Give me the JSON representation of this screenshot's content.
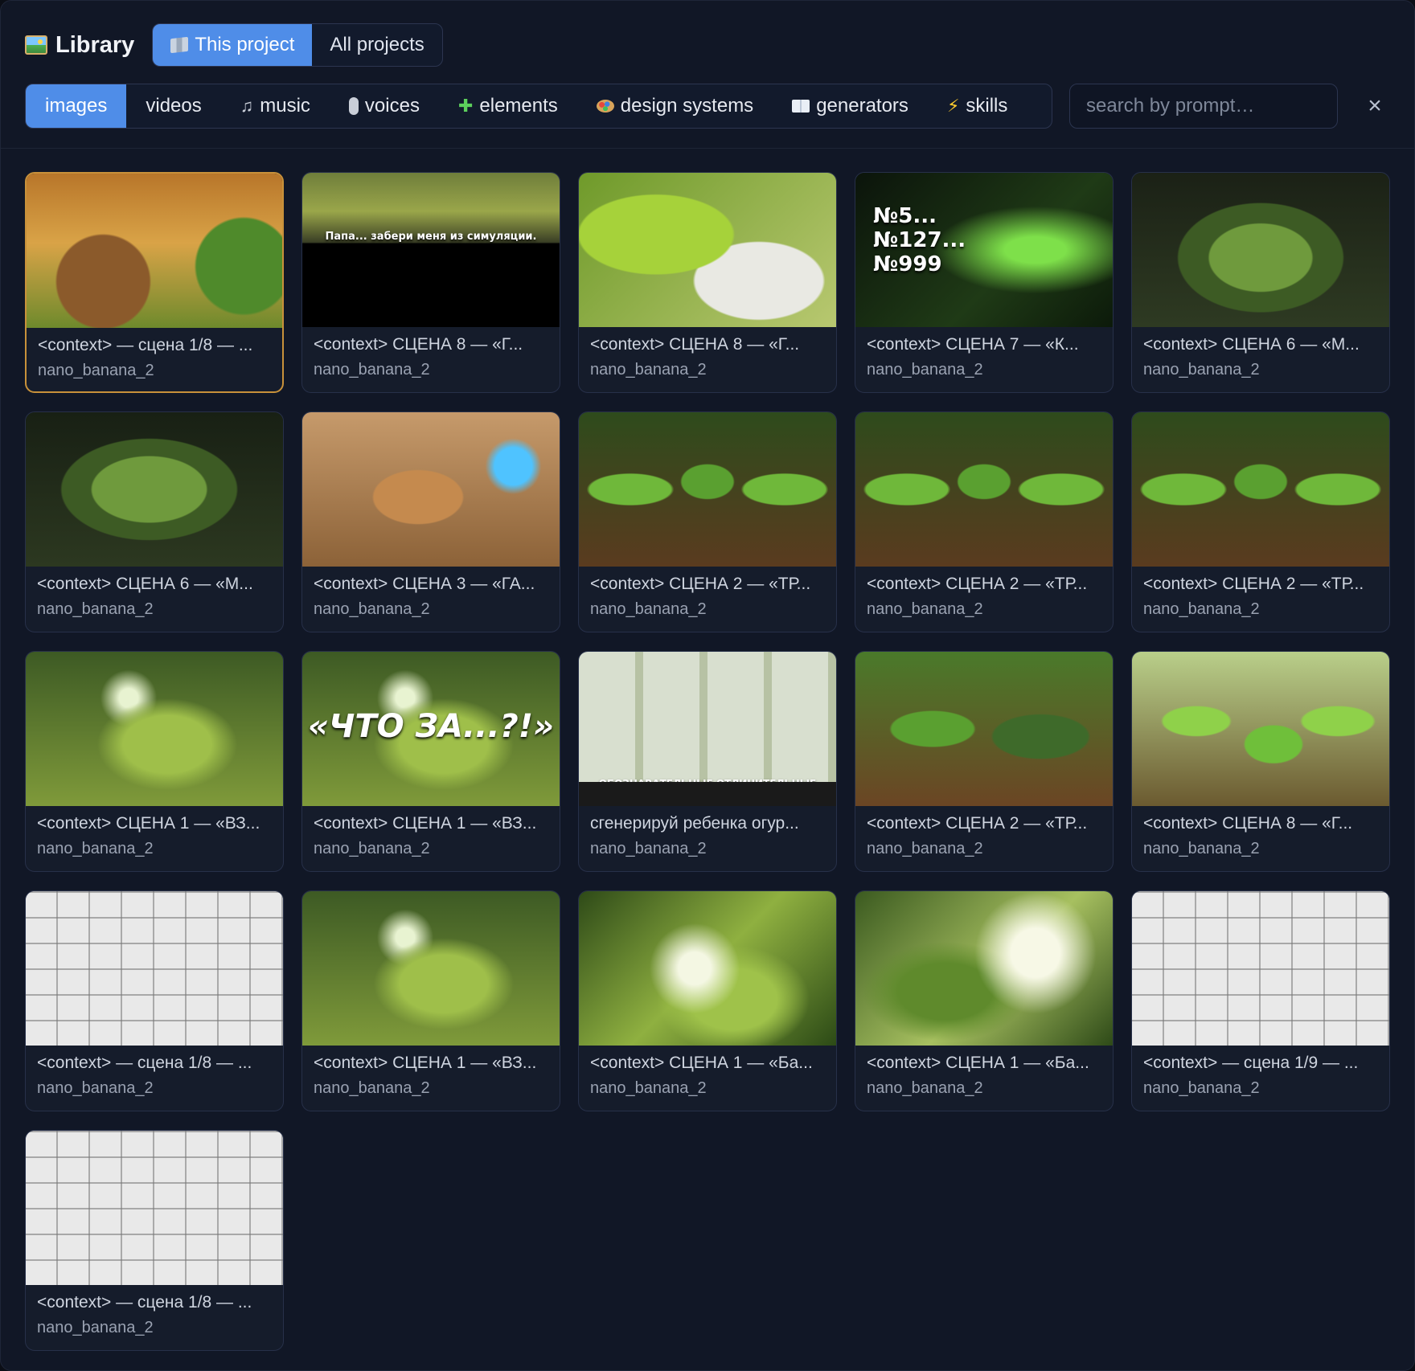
{
  "header": {
    "title": "Library",
    "scope_tabs": [
      {
        "label": "This project",
        "active": true
      },
      {
        "label": "All projects",
        "active": false
      }
    ]
  },
  "filters": [
    {
      "label": "images",
      "icon": "",
      "active": true
    },
    {
      "label": "videos",
      "icon": "",
      "active": false
    },
    {
      "label": "music",
      "icon": "music-note-icon",
      "active": false
    },
    {
      "label": "voices",
      "icon": "microphone-icon",
      "active": false
    },
    {
      "label": "elements",
      "icon": "puzzle-icon",
      "active": false
    },
    {
      "label": "design systems",
      "icon": "palette-icon",
      "active": false
    },
    {
      "label": "generators",
      "icon": "book-icon",
      "active": false
    },
    {
      "label": "skills",
      "icon": "lightning-icon",
      "active": false
    }
  ],
  "search": {
    "placeholder": "search by prompt…",
    "value": ""
  },
  "close_icon": "×",
  "items": [
    {
      "caption": "<context> — сцена 1/8 — ...",
      "model": "nano_banana_2",
      "thumb": "t-city",
      "overlay": "",
      "selected": true
    },
    {
      "caption": "<context> СЦЕНА 8 — «Г...",
      "model": "nano_banana_2",
      "thumb": "t-papa",
      "overlay": "Папа... забери меня из симуляции.",
      "selected": false
    },
    {
      "caption": "<context> СЦЕНА 8 — «Г...",
      "model": "nano_banana_2",
      "thumb": "t-pack",
      "overlay": "",
      "selected": false
    },
    {
      "caption": "<context> СЦЕНА 7 — «К...",
      "model": "nano_banana_2",
      "thumb": "t-roots",
      "overlay": "№5...\n№127...\n№999",
      "selected": false
    },
    {
      "caption": "<context> СЦЕНА 6 — «М...",
      "model": "nano_banana_2",
      "thumb": "t-glass",
      "overlay": "",
      "selected": false
    },
    {
      "caption": "<context> СЦЕНА 6 — «М...",
      "model": "nano_banana_2",
      "thumb": "t-glass2",
      "overlay": "",
      "selected": false
    },
    {
      "caption": "<context> СЦЕНА 3 — «ГА...",
      "model": "nano_banana_2",
      "thumb": "t-sheriff",
      "overlay": "",
      "selected": false
    },
    {
      "caption": "<context> СЦЕНА 2 — «ТР...",
      "model": "nano_banana_2",
      "thumb": "t-cukes",
      "overlay": "",
      "selected": false
    },
    {
      "caption": "<context> СЦЕНА 2 — «ТР...",
      "model": "nano_banana_2",
      "thumb": "t-cukes",
      "overlay": "",
      "selected": false
    },
    {
      "caption": "<context> СЦЕНА 2 — «ТР...",
      "model": "nano_banana_2",
      "thumb": "t-cukes",
      "overlay": "",
      "selected": false
    },
    {
      "caption": "<context> СЦЕНА 1 — «ВЗ...",
      "model": "nano_banana_2",
      "thumb": "t-jar",
      "overlay": "",
      "selected": false
    },
    {
      "caption": "<context> СЦЕНА 1 — «ВЗ...",
      "model": "nano_banana_2",
      "thumb": "t-jar",
      "overlay": "«ЧТО ЗА...?!»",
      "selected": false
    },
    {
      "caption": "сгенерируй ребенка огур...",
      "model": "nano_banana_2",
      "thumb": "t-panels",
      "overlay": "ОБОЗНАВАТЕЛЬНЫЕ ОТЛИЧИТЕЛЬНЫЕ ЗНАКИ",
      "selected": false
    },
    {
      "caption": "<context> СЦЕНА 2 — «ТР...",
      "model": "nano_banana_2",
      "thumb": "t-garden",
      "overlay": "",
      "selected": false
    },
    {
      "caption": "<context> СЦЕНА 8 — «Г...",
      "model": "nano_banana_2",
      "thumb": "t-field",
      "overlay": "",
      "selected": false
    },
    {
      "caption": "<context> — сцена 1/8 — ...",
      "model": "nano_banana_2",
      "thumb": "t-board",
      "overlay": "",
      "selected": false
    },
    {
      "caption": "<context> СЦЕНА 1 — «ВЗ...",
      "model": "nano_banana_2",
      "thumb": "t-jar",
      "overlay": "",
      "selected": false
    },
    {
      "caption": "<context> СЦЕНА 1 — «Ба...",
      "model": "nano_banana_2",
      "thumb": "t-splash",
      "overlay": "",
      "selected": false
    },
    {
      "caption": "<context> СЦЕНА 1 — «Ба...",
      "model": "nano_banana_2",
      "thumb": "t-splash2",
      "overlay": "",
      "selected": false
    },
    {
      "caption": "<context> — сцена 1/9 — ...",
      "model": "nano_banana_2",
      "thumb": "t-board",
      "overlay": "",
      "selected": false
    },
    {
      "caption": "<context> — сцена 1/8 — ...",
      "model": "nano_banana_2",
      "thumb": "t-board",
      "overlay": "",
      "selected": false
    }
  ]
}
